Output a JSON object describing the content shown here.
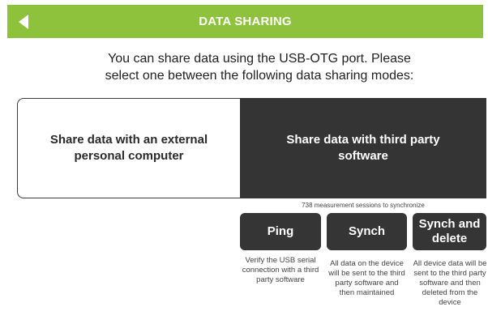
{
  "header": {
    "title": "DATA SHARING",
    "back_icon": "triangle-left-icon",
    "background": "#8fc23c"
  },
  "intro": {
    "line1": "You can share data using the USB-OTG port. Please",
    "line2": "select one between the following data sharing modes:"
  },
  "modes": {
    "external_pc": "Share data with an external personal computer",
    "third_party": "Share data with third party software",
    "selected": "third_party"
  },
  "sessions_note": "738 measurement sessions to synchronize",
  "actions": [
    {
      "label": "Ping",
      "description": "Verify the USB serial connection with a third party software"
    },
    {
      "label": "Synch",
      "description": "All data on the device will be sent to the third party software and then maintained"
    },
    {
      "label": "Synch and delete",
      "description": "All device data will be sent to the third party software and then deleted from the device"
    }
  ]
}
